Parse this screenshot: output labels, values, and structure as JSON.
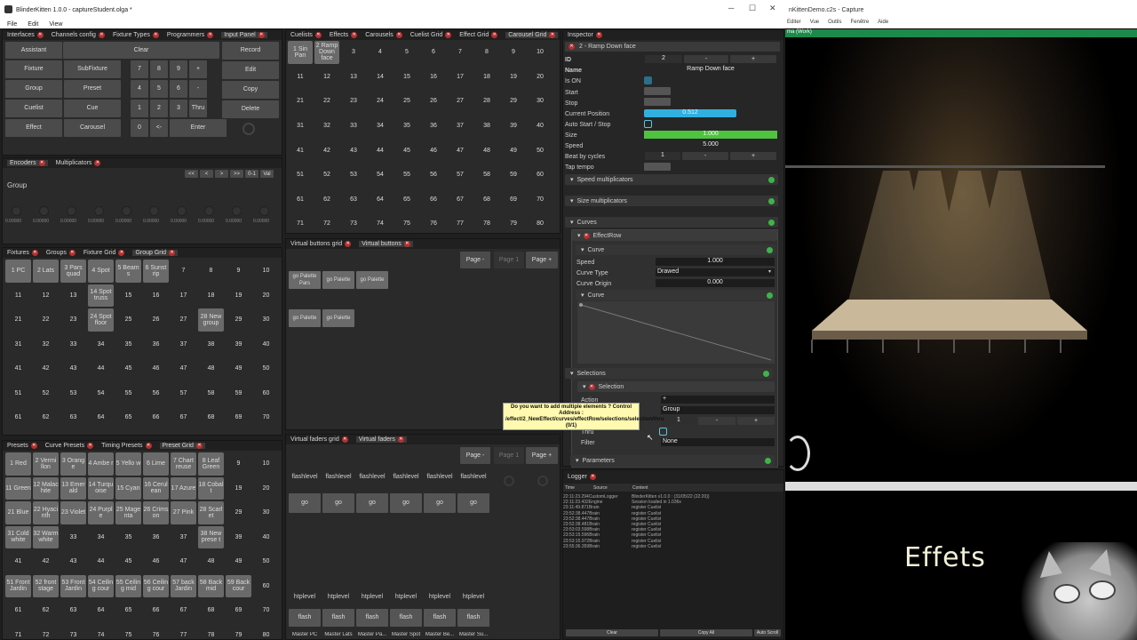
{
  "window": {
    "title": "BlinderKitten 1.0.0 - captureStudent.olga *",
    "menu": [
      "File",
      "Edit",
      "View"
    ]
  },
  "panels": {
    "top_left_tabs": [
      "Interfaces",
      "Channels config",
      "Fixture Types",
      "Programmers",
      "Input Panel"
    ],
    "input_panel": {
      "assistant": "Assistant",
      "clear": "Clear",
      "record": "Record",
      "edit": "Edit",
      "copy": "Copy",
      "delete": "Delete",
      "left_buttons": [
        "Fixture",
        "SubFixture",
        "Group",
        "Preset",
        "Cuelist",
        "Cue",
        "Effect",
        "Carousel"
      ],
      "keypad": [
        "7",
        "8",
        "9",
        "+",
        "4",
        "5",
        "6",
        "-",
        "1",
        "2",
        "3",
        "Thru",
        "0",
        "<-",
        "Enter"
      ]
    },
    "encoders": {
      "tabs": [
        "Encoders",
        "Multiplicators"
      ],
      "nav": [
        "<<",
        "<",
        ">",
        ">>",
        "0-1",
        "Val"
      ],
      "group_label": "Group",
      "value": "0.00000"
    },
    "fixtures_tabs": [
      "Fixtures",
      "Groups",
      "Fixture Grid",
      "Group Grid"
    ],
    "fixtures_named": {
      "1": "1 PC",
      "2": "2 Lats",
      "3": "3 Pars quad",
      "4": "4 Spot",
      "5": "5 Beam s",
      "6": "6 Sunst rip",
      "14": "14 Spot truss",
      "24": "24 Spot floor",
      "28": "28 New group"
    },
    "presets_tabs": [
      "Presets",
      "Curve Presets",
      "Timing Presets",
      "Preset Grid"
    ],
    "presets_named": {
      "1": "1 Red",
      "2": "2 Vermi llon",
      "3": "3 Orang e",
      "4": "4 Ambe r",
      "5": "5 Yello w",
      "6": "6 Lime",
      "7": "7 Chart reuse",
      "8": "8 Leaf Green",
      "11": "11 Green",
      "12": "12 Malac hite",
      "13": "13 Emer ald",
      "14": "14 Turqu oise",
      "15": "15 Cyan",
      "16": "16 Cerul ean",
      "17": "17 Azure",
      "18": "18 Cobal t",
      "21": "21 Blue",
      "22": "22 Hyaci nth",
      "23": "23 Violet",
      "24": "24 Purpl e",
      "25": "25 Mage nta",
      "26": "26 Crims on",
      "27": "27 Pink",
      "28": "28 Scarl et",
      "31": "31 Cold white",
      "32": "32 Warm white",
      "38": "38 New prese t",
      "51": "51 Front Jardin",
      "52": "52 front stage",
      "53": "53 Front Jardin",
      "54": "54 Ceilin g cour",
      "55": "55 Ceilin g mid",
      "56": "56 Ceilin g cour",
      "57": "57 back Jardin",
      "58": "58 Back mid",
      "59": "59 Back cour"
    },
    "cuelists_tabs": [
      "Cuelists",
      "Effects",
      "Carousels",
      "Cuelist Grid",
      "Effect Grid",
      "Carousel Grid"
    ],
    "cuelists_named": {
      "1": "1 Sin Pan",
      "2": "2 Ramp Down face"
    },
    "virtual_buttons": {
      "tabs": [
        "Virtual buttons grid",
        "Virtual buttons"
      ],
      "page_minus": "Page -",
      "page": "Page 1",
      "page_plus": "Page +",
      "buttons": [
        "go Palette Pars",
        "go Palette",
        "go Palette",
        "go Palette",
        "go Palette"
      ]
    },
    "virtual_faders": {
      "tabs": [
        "Virtual faders grid",
        "Virtual faders"
      ],
      "page_minus": "Page -",
      "page": "Page 1",
      "page_plus": "Page +",
      "top_labels": [
        "flashlevel",
        "flashlevel",
        "flashlevel",
        "flashlevel",
        "flashlevel",
        "flashlevel"
      ],
      "go": [
        "go",
        "go",
        "go",
        "go",
        "go",
        "go"
      ],
      "htp": [
        "htplevel",
        "htplevel",
        "htplevel",
        "htplevel",
        "htplevel",
        "htplevel"
      ],
      "flash": [
        "flash",
        "flash",
        "flash",
        "flash",
        "flash",
        "flash"
      ],
      "masters": [
        "Master PC",
        "Master Lats",
        "Master Pa...",
        "Master Spot",
        "Master Be...",
        "Master Su..."
      ]
    }
  },
  "inspector": {
    "tab": "Inspector",
    "header": "2 - Ramp Down face",
    "id_label": "ID",
    "id": "2",
    "name_label": "Name",
    "name": "Ramp Down face",
    "is_on": "Is ON",
    "start": "Start",
    "stop": "Stop",
    "current_position_label": "Current Position",
    "current_position": "0.512",
    "current_position_fraction": 0.512,
    "auto_start_label": "Auto Start / Stop",
    "size_label": "Size",
    "size": "1.000",
    "speed_label": "Speed",
    "speed": "5.000",
    "beat_label": "Beat by cycles",
    "beat": "1",
    "tap_tempo": "Tap tempo",
    "speed_mult": "Speed multiplicators",
    "size_mult": "Size multiplicators",
    "curves": "Curves",
    "effect_row": "EffectRow",
    "curve": "Curve",
    "curve_speed_label": "Speed",
    "curve_speed": "1.000",
    "curve_type_label": "Curve Type",
    "curve_type": "Drawed",
    "curve_origin_label": "Curve Origin",
    "curve_origin": "0.000",
    "curve_sub": "Curve",
    "selections": "Selections",
    "selection": "Selection",
    "action_label": "Action",
    "action": "+",
    "group_value": "Group",
    "thru_label": "Thru",
    "thru": "1",
    "filter_label": "Filter",
    "filter": "None",
    "parameters": "Parameters",
    "tooltip": "Do you want to add multiple elements ? Control Address : /effect/2_NewEffect/curves/effectRow/selections/selection/thru (0/1)"
  },
  "logger": {
    "tab": "Logger",
    "cols": [
      "Time",
      "Source",
      "Content"
    ],
    "rows": [
      [
        "22:11:23.294",
        "CustomLogger",
        "BlinderKitten v1.0.0 : (31/05/22 (22:20))"
      ],
      [
        "22:11:23.432",
        "Engine",
        "Session loaded in 1.036s"
      ],
      [
        "23:11:49.871",
        "Brain",
        "register Cuelist"
      ],
      [
        "23:52:38.447",
        "Brain",
        "register Cuelist"
      ],
      [
        "23:52:38.447",
        "Brain",
        "register Cuelist"
      ],
      [
        "23:52:38.481",
        "Brain",
        "register Cuelist"
      ],
      [
        "23:53:03.598",
        "Brain",
        "register Cuelist"
      ],
      [
        "23:53:15.596",
        "Brain",
        "register Cuelist"
      ],
      [
        "23:53:15.972",
        "Brain",
        "register Cuelist"
      ],
      [
        "23:55:36.359",
        "Brain",
        "register Cuelist"
      ]
    ],
    "clear": "Clear",
    "copy_all": "Copy All",
    "auto_scroll": "Auto Scroll"
  },
  "video": {
    "window_title": "nKittenDemo.c2s - Capture",
    "menu": [
      "Editer",
      "Vue",
      "Outils",
      "Fenêtre",
      "Aide"
    ],
    "scene_tab": "ma (Work)",
    "caption": "Effets"
  },
  "colors": {
    "accent_blue": "#31b0e0",
    "size_green": "#4fc340",
    "close_red": "#b53030",
    "ok_green": "#3fb34a"
  }
}
